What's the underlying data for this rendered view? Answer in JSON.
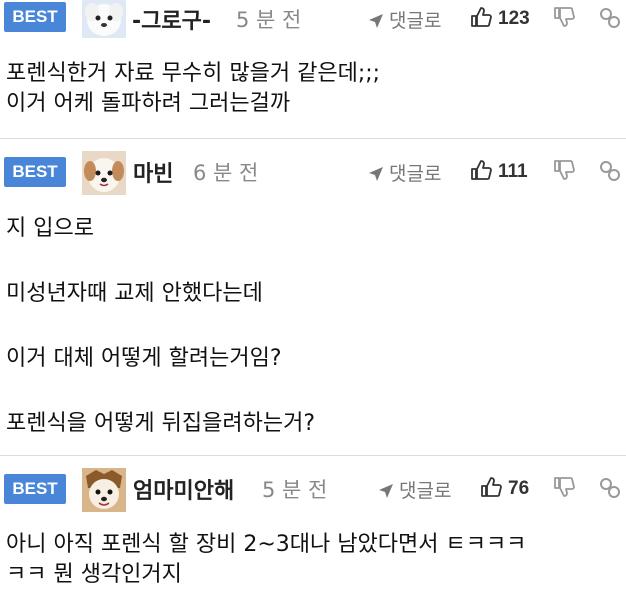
{
  "comments": [
    {
      "badge": "BEST",
      "nickname": "-그로구-",
      "time": "5 분 전",
      "reply_label": "댓글로",
      "likes": "123",
      "avatar": "white-puppy-avatar",
      "lines": [
        "포렌식한거 자료 무수히 많을거 같은데;;;",
        "이거 어케 돌파하려 그러는걸까"
      ]
    },
    {
      "badge": "BEST",
      "nickname": "마빈",
      "time": "6 분 전",
      "reply_label": "댓글로",
      "likes": "111",
      "avatar": "puppy-face-avatar",
      "lines": [
        "지 입으로",
        "",
        "미성년자때 교제 안했다는데",
        "",
        "이거 대체 어떻게 할려는거임?",
        "",
        "포렌식을 어떻게 뒤집을려하는거?"
      ]
    },
    {
      "badge": "BEST",
      "nickname": "엄마미안해",
      "time": "5 분 전",
      "reply_label": "댓글로",
      "likes": "76",
      "avatar": "puppy-face-avatar",
      "lines": [
        "아니 아직 포렌식 할 장비 2~3대나 남았다면서 ㅌㅋㅋㅋ",
        "ㅋㅋ 뭔 생각인거지"
      ]
    }
  ],
  "colors": {
    "badge": "#4a86d8",
    "separator": "#dcdcdc",
    "muted": "#888888"
  }
}
